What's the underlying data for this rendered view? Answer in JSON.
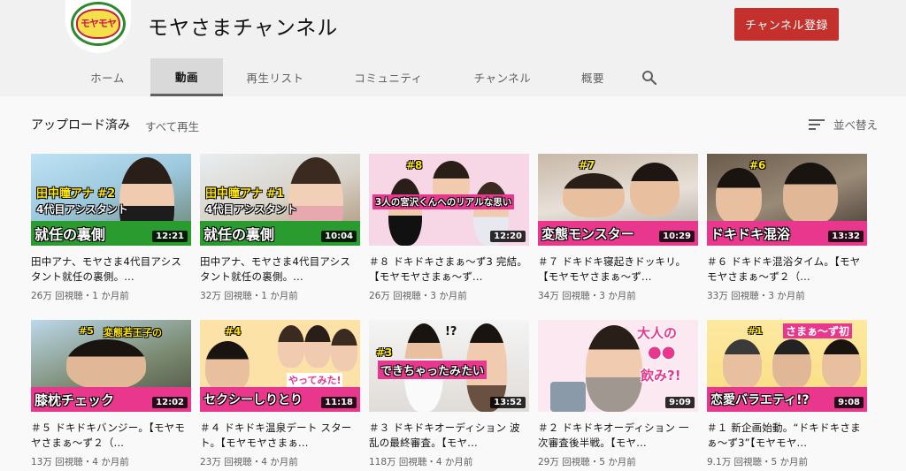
{
  "channel": {
    "name": "モヤさまチャンネル",
    "logo_text": "モヤモヤ",
    "subscribe_label": "チャンネル登録"
  },
  "tabs": [
    {
      "label": "ホーム"
    },
    {
      "label": "動画"
    },
    {
      "label": "再生リスト"
    },
    {
      "label": "コミュニティ"
    },
    {
      "label": "チャンネル"
    },
    {
      "label": "概要"
    }
  ],
  "section": {
    "title": "アップロード済み",
    "play_all": "すべて再生",
    "sort_label": "並べ替え"
  },
  "videos": [
    {
      "title": "田中アナ、モヤさま4代目アシスタント就任の裏側。...",
      "meta": "26万 回視聴・1 か月前",
      "duration": "12:21",
      "caption1": "田中瞳アナ #2",
      "caption2": "4代目アシスタント",
      "caption3": "就任の裏側",
      "accent": "#f5c800"
    },
    {
      "title": "田中アナ、モヤさま4代目アシスタント就任の裏側。...",
      "meta": "32万 回視聴・1 か月前",
      "duration": "10:04",
      "caption1": "田中瞳アナ #1",
      "caption2": "4代目アシスタント",
      "caption3": "就任の裏側",
      "accent": "#f5c800"
    },
    {
      "title": "＃８ ドキドキさまぁ～ず3 完結。【モヤモヤさまぁ～ず...",
      "meta": "26万 回視聴・3 か月前",
      "duration": "12:20",
      "caption1": "#8",
      "caption2": "3人の宮沢くんへのリアルな思い",
      "caption3": "",
      "accent": "#e8378c"
    },
    {
      "title": "＃７ ドキドキ寝起きドッキリ。【モヤモヤさまぁ～ず...",
      "meta": "34万 回視聴・3 か月前",
      "duration": "10:29",
      "caption1": "#7",
      "caption2": "変態モンスター",
      "caption3": "",
      "accent": "#e8378c"
    },
    {
      "title": "＃６ ドキドキ混浴タイム。【モヤモヤさまぁ～ず２（...",
      "meta": "33万 回視聴・3 か月前",
      "duration": "13:32",
      "caption1": "#6",
      "caption2": "ドキドキ混浴",
      "caption3": "",
      "accent": "#e8378c"
    },
    {
      "title": "＃５ ドキドキバンジー。【モヤモヤさまぁ～ず２（...",
      "meta": "13万 回視聴・4 か月前",
      "duration": "12:02",
      "caption1": "変態若王子の",
      "caption2": "膝枕チェック",
      "caption3": "#5",
      "accent": "#e8378c"
    },
    {
      "title": "＃４ ドキドキ温泉デート スタート。【モヤモヤさまぁ...",
      "meta": "23万 回視聴・4 か月前",
      "duration": "11:18",
      "caption1": "#4",
      "caption2": "セクシーしりとり",
      "caption3": "やってみた!",
      "accent": "#e8378c"
    },
    {
      "title": "＃３ ドキドキオーディション 波乱の最終審査。【モヤ...",
      "meta": "118万 回視聴・4 か月前",
      "duration": "13:52",
      "caption1": "#3",
      "caption2": "できちゃったみたい",
      "caption3": "!?",
      "accent": "#e8378c"
    },
    {
      "title": "＃２ ドキドキオーディション 一次審査後半戦。【モヤ...",
      "meta": "29万 回視聴・5 か月前",
      "duration": "9:09",
      "caption1": "大人の",
      "caption2": "●●",
      "caption3": "飲み?!",
      "accent": "#e8378c"
    },
    {
      "title": "＃１ 新企画始動。“ドキドキさまぁ～ず3”【モヤモヤ...",
      "meta": "9.1万 回視聴・5 か月前",
      "duration": "9:08",
      "caption1": "さまぁ～ず初",
      "caption2": "恋愛バラエティ!?",
      "caption3": "#1",
      "accent": "#e8378c"
    }
  ]
}
